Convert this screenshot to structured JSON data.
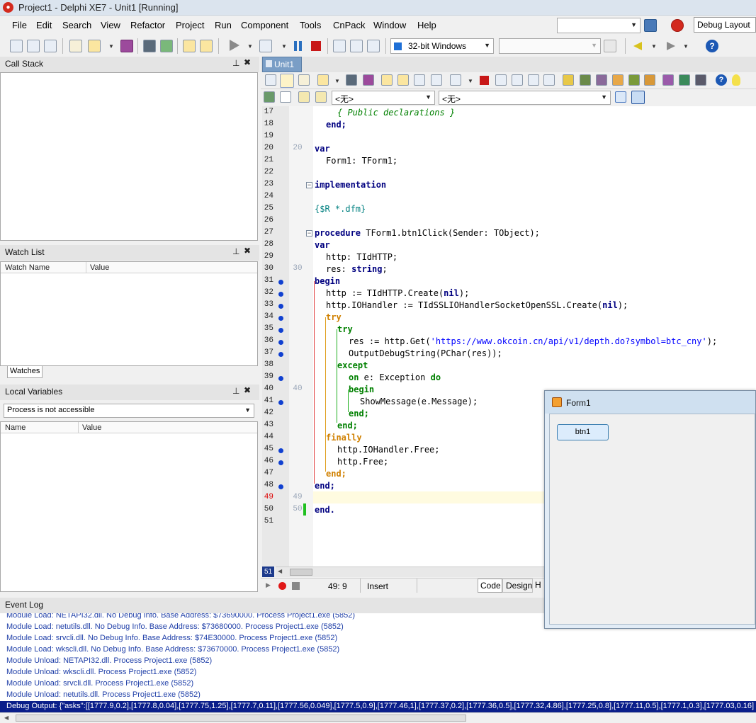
{
  "window": {
    "title": "Project1 - Delphi XE7 - Unit1 [Running]"
  },
  "menu": [
    "File",
    "Edit",
    "Search",
    "View",
    "Refactor",
    "Project",
    "Run",
    "Component",
    "Tools",
    "CnPack",
    "Window",
    "Help"
  ],
  "layout_combo": {
    "value": "Debug Layout"
  },
  "platform_combo": {
    "value": "32-bit Windows"
  },
  "editor_tab": "Unit1",
  "class_combo": "<无>",
  "method_combo": "<无>",
  "panels": {
    "call_stack": {
      "title": "Call Stack"
    },
    "watch_list": {
      "title": "Watch List",
      "columns": [
        "Watch Name",
        "Value"
      ],
      "tab": "Watches"
    },
    "local_vars": {
      "title": "Local Variables",
      "combo": "Process is not accessible",
      "columns": [
        "Name",
        "Value"
      ]
    },
    "event_log": {
      "title": "Event Log",
      "lines": [
        "Module Load: NETAPI32.dll. No Debug Info. Base Address: $73690000. Process Project1.exe (5852)",
        "Module Load: netutils.dll. No Debug Info. Base Address: $73680000. Process Project1.exe (5852)",
        "Module Load: srvcli.dll. No Debug Info. Base Address: $74E30000. Process Project1.exe (5852)",
        "Module Load: wkscli.dll. No Debug Info. Base Address: $73670000. Process Project1.exe (5852)",
        "Module Unload: NETAPI32.dll. Process Project1.exe (5852)",
        "Module Unload: wkscli.dll. Process Project1.exe (5852)",
        "Module Unload: srvcli.dll. Process Project1.exe (5852)",
        "Module Unload: netutils.dll. Process Project1.exe (5852)"
      ],
      "selected": "Debug Output: {\"asks\":[[1777.9,0.2],[1777.8,0.04],[1777.75,1.25],[1777.7,0.11],[1777.56,0.049],[1777.5,0.9],[1777.46,1],[1777.37,0.2],[1777.36,0.5],[1777.32,4.86],[1777.25,0.8],[1777.11,0.5],[1777.1,0.3],[1777.03,0.16]"
    }
  },
  "editor": {
    "line_numbers": [
      "17",
      "18",
      "19",
      "20",
      "21",
      "22",
      "23",
      "24",
      "25",
      "26",
      "27",
      "28",
      "29",
      "30",
      "31",
      "32",
      "33",
      "34",
      "35",
      "36",
      "37",
      "38",
      "39",
      "40",
      "41",
      "42",
      "43",
      "44",
      "45",
      "46",
      "47",
      "48",
      "49",
      "50",
      "51"
    ],
    "fold_labels": [
      "20",
      "30",
      "40",
      "49",
      "50"
    ],
    "code": {
      "l17": "{ Public declarations }",
      "l18": "end;",
      "l20": "var",
      "l21": "Form1: TForm1;",
      "l23": "implementation",
      "l25": "{$R *.dfm}",
      "l27_kw": "procedure",
      "l27_rest": " TForm1.btn1Click(Sender: TObject);",
      "l28": "var",
      "l29": "http: TIdHTTP;",
      "l30_a": "res: ",
      "l30_kw": "string",
      "l30_b": ";",
      "l31": "begin",
      "l32_a": "http := TIdHTTP.Create(",
      "l32_kw": "nil",
      "l32_b": ");",
      "l33_a": "http.IOHandler := TIdSSLIOHandlerSocketOpenSSL.Create(",
      "l33_kw": "nil",
      "l33_b": ");",
      "l34": "try",
      "l35": "try",
      "l36_a": "res := http.Get(",
      "l36_str": "'https://www.okcoin.cn/api/v1/depth.do?symbol=btc_cny'",
      "l36_b": ");",
      "l37": "OutputDebugString(PChar(res));",
      "l38": "except",
      "l39_kw1": "on",
      "l39_mid": " e: Exception ",
      "l39_kw2": "do",
      "l40": "begin",
      "l41": "ShowMessage(e.Message);",
      "l42": "end;",
      "l43": "end;",
      "l44": "finally",
      "l45": "http.IOHandler.Free;",
      "l46": "http.Free;",
      "l47": "end;",
      "l48": "end;",
      "l50": "end."
    }
  },
  "status": {
    "position": "49:  9",
    "mode": "Insert",
    "line_badge": "51"
  },
  "bottom_tabs": [
    "Code",
    "Design",
    "H"
  ],
  "form_window": {
    "title": "Form1",
    "button": "btn1"
  },
  "colors": {
    "keyword": "#000080",
    "try_keyword": "#008000",
    "comment": "#008000",
    "string": "#0000ff",
    "breakpoint_dot": "#1040d0",
    "event_text": "#1f3fa8",
    "selection": "#000080"
  }
}
